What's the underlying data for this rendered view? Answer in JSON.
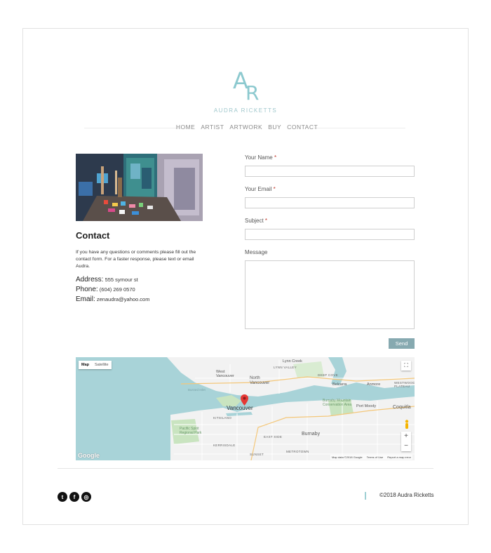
{
  "brand": {
    "initial_a": "A",
    "initial_r": "R",
    "name": "AUDRA RICKETTS",
    "accent": "#8cc9cf"
  },
  "nav": {
    "items": [
      {
        "label": "HOME"
      },
      {
        "label": "ARTIST"
      },
      {
        "label": "ARTWORK"
      },
      {
        "label": "BUY"
      },
      {
        "label": "CONTACT"
      }
    ]
  },
  "contact": {
    "title": "Contact",
    "intro": "If you have any questions or comments please fill out the contact form. For a faster response, please text or email Audra.",
    "address_label": "Address:",
    "address": "555 symour st",
    "phone_label": "Phone:",
    "phone": "(604) 269 0570",
    "email_label": "Email:",
    "email": "zenaudra@yahoo.com"
  },
  "form": {
    "name_label": "Your Name",
    "email_label": "Your Email",
    "subject_label": "Subject",
    "message_label": "Message",
    "required_mark": "*",
    "send_label": "Send",
    "send_color": "#86a9b0"
  },
  "map": {
    "tab_map": "Map",
    "tab_satellite": "Satellite",
    "zoom_in": "+",
    "zoom_out": "−",
    "places": {
      "vancouver": "Vancouver",
      "north_vancouver": "North Vancouver",
      "west_vancouver": "West Vancouver",
      "burnaby": "Burnaby",
      "port_moody": "Port Moody",
      "coquitlam": "Coquitla",
      "belcarra": "Belcarra",
      "anmore": "Anmore",
      "westwood_plateau": "WESTWOOD PLATEAU",
      "lynn_creek": "Lynn Creek",
      "lynn_valley": "LYNN VALLEY",
      "deep_cove": "DEEP COVE",
      "kitsilano": "KITSILANO",
      "east_side": "EAST SIDE",
      "kerrisdale": "KERRISDALE",
      "sunset": "SUNSET",
      "metrotown": "METROTOWN",
      "pacific_spirit": "Pacific Spirit Regional Park",
      "burnaby_mountain": "Burnaby Mountain Conservation Area",
      "burrard_inlet": "Burrard Inlet"
    },
    "attribution": "Map data ©2018 Google",
    "terms": "Terms of Use",
    "report": "Report a map error",
    "google": "Google",
    "water_color": "#a8d3d8",
    "land_color": "#f2f2f2",
    "pin_color": "#e53935"
  },
  "footer": {
    "social": [
      {
        "icon": "twitter-icon",
        "glyph": "t"
      },
      {
        "icon": "facebook-icon",
        "glyph": "f"
      },
      {
        "icon": "instagram-icon",
        "glyph": "◎"
      }
    ],
    "copyright": "©2018 Audra Ricketts"
  }
}
